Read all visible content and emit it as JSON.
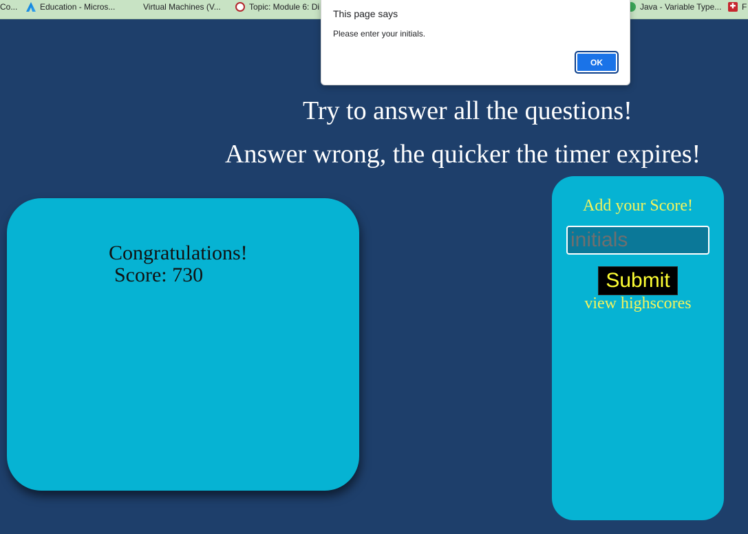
{
  "bookmarks": [
    {
      "label": "Co...",
      "icon": "generic-icon"
    },
    {
      "label": "Education - Micros...",
      "icon": "azure-icon"
    },
    {
      "label": "Virtual Machines (V...",
      "icon": "microsoft-icon"
    },
    {
      "label": "Topic: Module 6: Di",
      "icon": "moodle-icon"
    },
    {
      "label": "Java - Variable Type...",
      "icon": "java-icon"
    },
    {
      "label": "F",
      "icon": "red-app-icon"
    }
  ],
  "headings": {
    "line1": "Try to answer all the questions!",
    "line2": "Answer wrong, the quicker the timer expires!"
  },
  "score_card": {
    "congrats": "Congratulations!",
    "score": "Score: 730"
  },
  "sidebar": {
    "add_score": "Add your Score!",
    "initials_placeholder": "initials",
    "submit_label": "Submit",
    "view_highscores": "view highscores"
  },
  "dialog": {
    "title": "This page says",
    "message": "Please enter your initials.",
    "ok_label": "OK"
  },
  "colors": {
    "page_bg": "#1e3f6b",
    "card_bg": "#06b3d3",
    "accent_yellow": "#f4f45c",
    "dialog_button": "#1a73e8"
  }
}
